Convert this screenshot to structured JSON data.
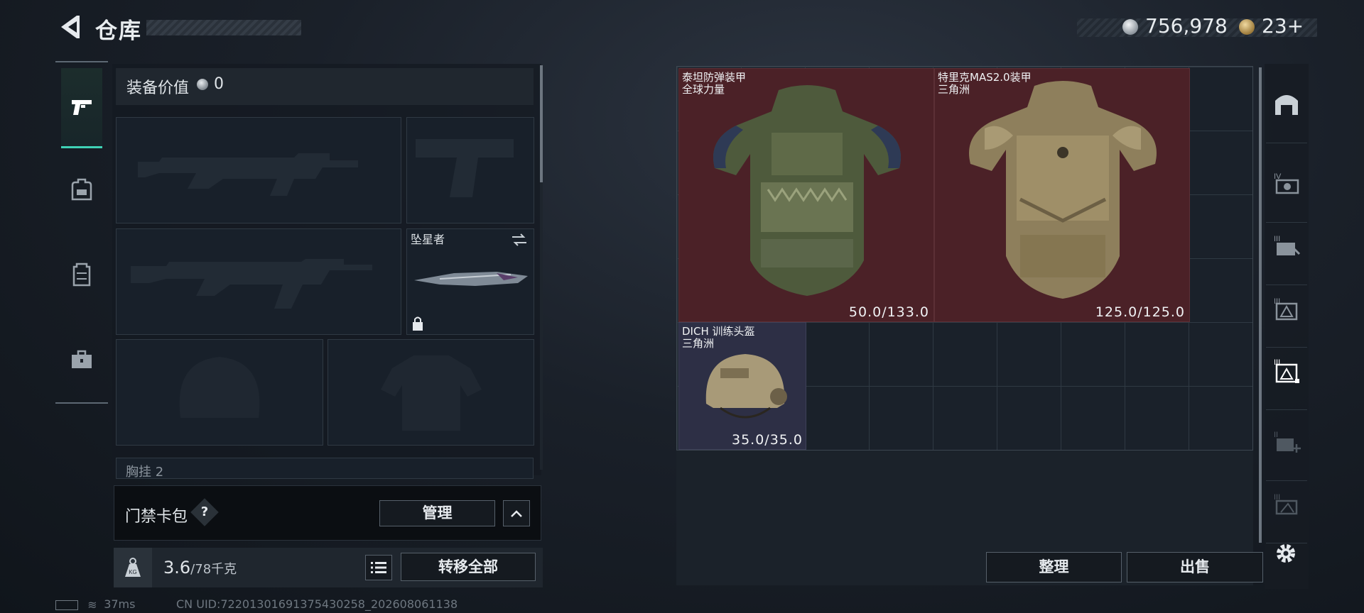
{
  "header": {
    "title": "仓库",
    "currency_value": "756,978",
    "ticket_value": "23",
    "ticket_plus": "+"
  },
  "icons": {
    "back": "back-arrow-icon",
    "currency": "silver-coin-icon",
    "ticket": "gold-token-icon"
  },
  "left_tabs": [
    {
      "name": "weapons",
      "icon": "pistol-icon",
      "selected": true
    },
    {
      "name": "backpack",
      "icon": "backpack-icon",
      "selected": false
    },
    {
      "name": "chest-rig",
      "icon": "vest-icon",
      "selected": false
    },
    {
      "name": "case",
      "icon": "briefcase-icon",
      "selected": false
    }
  ],
  "equipment": {
    "value_label": "装备价值",
    "value_amount": "0",
    "melee_name": "坠星者",
    "chest_label": "胸挂",
    "chest_count": "2"
  },
  "keycard": {
    "label": "门禁卡包",
    "help": "?",
    "manage_label": "管理"
  },
  "weight": {
    "current": "3.6",
    "max": "/78千克",
    "icon_label": "KG",
    "transfer_all_label": "转移全部"
  },
  "status": {
    "ping": "37ms",
    "uid": "CN UID:722013016913754302​58_202608061138"
  },
  "storage": {
    "items": [
      {
        "name": "泰坦防弹装甲",
        "maker": "全球力量",
        "durability": "50.0/133.0",
        "rarity_color": "#4b2127"
      },
      {
        "name": "特里克MAS2.0装甲",
        "maker": "三角洲",
        "durability": "125.0/125.0",
        "rarity_color": "#4b2127"
      },
      {
        "name": "DICH 训练头盔",
        "maker": "三角洲",
        "durability": "35.0/35.0",
        "rarity_color": "#2d2f45"
      }
    ],
    "sort_label": "整理",
    "sell_label": "出售"
  },
  "right_filters": [
    {
      "icon": "all-items-icon",
      "tier": ""
    },
    {
      "icon": "tier-iv-item-icon",
      "tier": "IV"
    },
    {
      "icon": "tier-iii-key-icon",
      "tier": "III"
    },
    {
      "icon": "tier-iii-armor-icon",
      "tier": "III"
    },
    {
      "icon": "tier-iii-armor-selected-icon",
      "tier": "III",
      "selected": true
    },
    {
      "icon": "tier-ii-medical-icon",
      "tier": "II"
    },
    {
      "icon": "tier-iii-misc-icon",
      "tier": "III"
    }
  ],
  "colors": {
    "accent": "#3fd2b6",
    "red_rarity": "#4b2127",
    "purple_rarity": "#2d2f45"
  }
}
